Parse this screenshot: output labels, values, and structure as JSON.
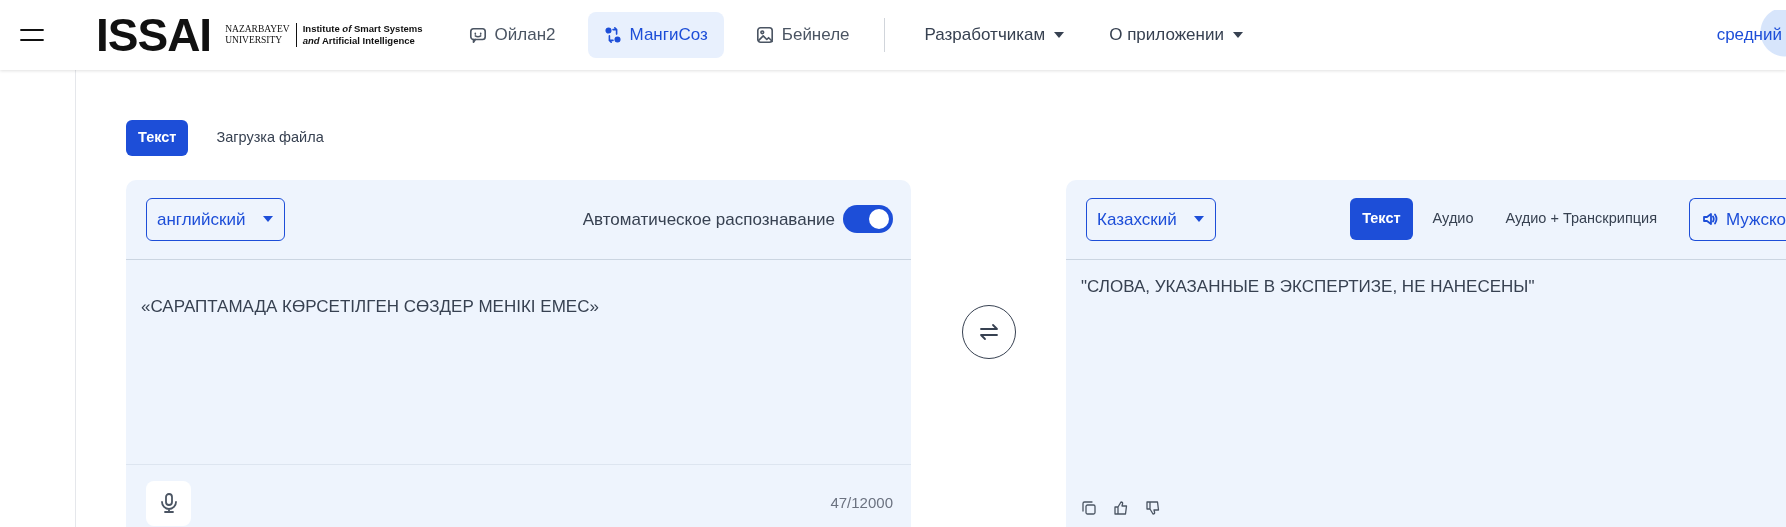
{
  "header": {
    "logo": {
      "mark": "ISSAI",
      "university": [
        "NAZARBAYEV",
        "UNIVERSITY"
      ],
      "institute": [
        "Institute *of* Smart Systems",
        "*and* Artificial Intelligence"
      ]
    },
    "nav": [
      {
        "label": "Ойлан2",
        "selected": false
      },
      {
        "label": "МангиСоз",
        "selected": true
      },
      {
        "label": "Бейнеле",
        "selected": false
      }
    ],
    "menus": [
      {
        "label": "Разработчикам"
      },
      {
        "label": "О приложении"
      }
    ],
    "level_button": "средний"
  },
  "input_tabs": [
    {
      "label": "Текст",
      "selected": true
    },
    {
      "label": "Загрузка файла",
      "selected": false
    }
  ],
  "source": {
    "language": "английский",
    "auto_detect": {
      "label": "Автоматическое распознавание",
      "on": true
    },
    "text": "«САРАПТАМАДА КӨРСЕТІЛГЕН СӨЗДЕР МЕНІКІ ЕМЕС»",
    "char_count": "47/12000"
  },
  "target": {
    "language": "Казахский",
    "modes": [
      {
        "label": "Текст",
        "selected": true
      },
      {
        "label": "Аудио",
        "selected": false
      },
      {
        "label": "Аудио + Транскрипция",
        "selected": false
      }
    ],
    "voice": "Мужско",
    "text": "\"СЛОВА, УКАЗАННЫЕ В ЭКСПЕРТИЗЕ, НЕ НАНЕСЕНЫ\""
  }
}
